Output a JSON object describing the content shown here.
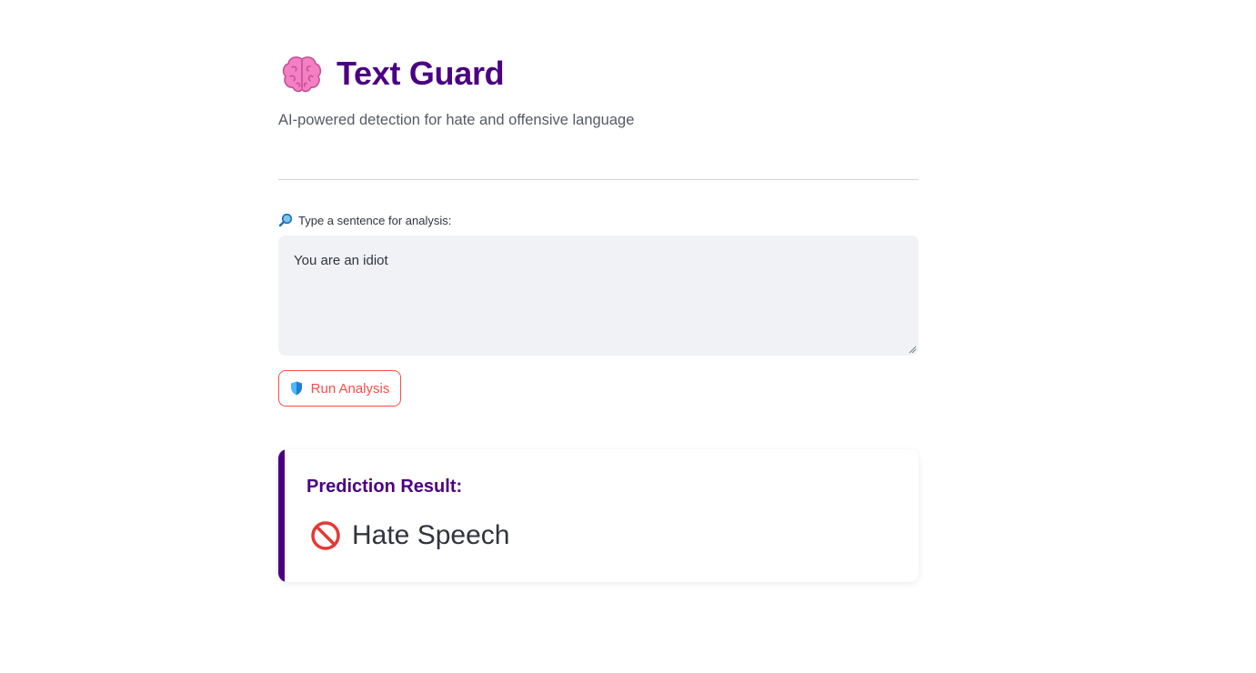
{
  "header": {
    "icon": "brain-icon",
    "title": "Text Guard",
    "subtitle": "AI-powered detection for hate and offensive language"
  },
  "input": {
    "label_icon": "magnifier-icon",
    "label": "Type a sentence for analysis:",
    "value": "You are an idiot"
  },
  "actions": {
    "run_icon": "shield-icon",
    "run_label": "Run Analysis"
  },
  "result": {
    "heading": "Prediction Result:",
    "icon": "prohibited-icon",
    "value": "Hate Speech"
  },
  "colors": {
    "brand": "#4b0082",
    "accent": "#ff4b4b",
    "input_bg": "#f0f2f6",
    "text": "#31333f"
  }
}
